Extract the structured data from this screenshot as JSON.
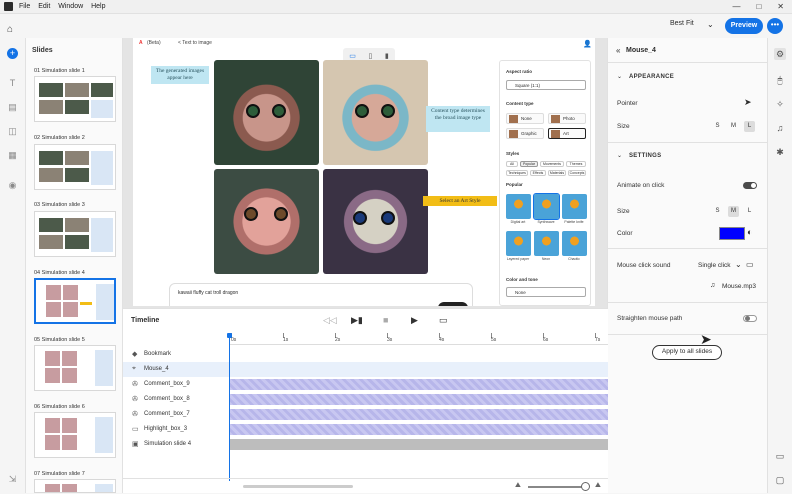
{
  "menu": [
    "File",
    "Edit",
    "Window",
    "Help"
  ],
  "window_controls": [
    "—",
    "□",
    "✕"
  ],
  "topbar": {
    "fit": "Best Fit",
    "preview": "Preview",
    "more": "•••"
  },
  "slides_panel": {
    "title": "Slides",
    "slides": [
      {
        "label": "01  Simulation slide 1"
      },
      {
        "label": "02  Simulation slide 2"
      },
      {
        "label": "03  Simulation slide 3"
      },
      {
        "label": "04  Simulation slide 4"
      },
      {
        "label": "05  Simulation slide 5"
      },
      {
        "label": "06  Simulation slide 6"
      },
      {
        "label": "07  Simulation slide 7"
      }
    ]
  },
  "canvas": {
    "header": {
      "logo": "A",
      "beta": "(Beta)",
      "back": "< Text to image"
    },
    "callout_generated": "The generated images appear here",
    "callout_content": "Content type determines the broad image type",
    "callout_art": "Select an Art Style",
    "prompt": "kawaii fluffy cat troll dragon",
    "panel": {
      "aspect_ratio_label": "Aspect ratio",
      "aspect_ratio_value": "Square (1:1)",
      "content_type_label": "Content type",
      "content_types": [
        "None",
        "Photo",
        "Graphic",
        "Art"
      ],
      "styles_label": "Styles",
      "style_chips": [
        "All",
        "Popular",
        "Movements",
        "Themes",
        "Techniques",
        "Effects",
        "Materials",
        "Concepts"
      ],
      "popular_label": "Popular",
      "popular_items": [
        "Digital art",
        "Synthwave",
        "Palette knife",
        "Layered paper",
        "Neon",
        "Chaotic"
      ],
      "color_tone_label": "Color and tone",
      "color_tone_value": "None"
    }
  },
  "timeline": {
    "title": "Timeline",
    "ticks": [
      "0s",
      "1s",
      "2s",
      "3s",
      "4s",
      "5s",
      "6s",
      "7s"
    ],
    "rows": [
      {
        "label": "Bookmark",
        "icon": "◆"
      },
      {
        "label": "Mouse_4",
        "icon": "⌖"
      },
      {
        "label": "Comment_box_9",
        "icon": "✇"
      },
      {
        "label": "Comment_box_8",
        "icon": "✇"
      },
      {
        "label": "Comment_box_7",
        "icon": "✇"
      },
      {
        "label": "Highlight_box_3",
        "icon": "▭"
      },
      {
        "label": "Simulation slide 4",
        "icon": "▣"
      }
    ]
  },
  "properties": {
    "title": "Mouse_4",
    "appearance_label": "APPEARANCE",
    "pointer_label": "Pointer",
    "size_label": "Size",
    "sizes": [
      "S",
      "M",
      "L"
    ],
    "settings_label": "SETTINGS",
    "animate_label": "Animate on click",
    "size2_label": "Size",
    "color_label": "Color",
    "color_value": "#0000ff",
    "sound_label": "Mouse click sound",
    "sound_value": "Single click",
    "sound_file": "Mouse.mp3",
    "straighten_label": "Straighten mouse path",
    "apply_label": "Apply to all slides"
  }
}
